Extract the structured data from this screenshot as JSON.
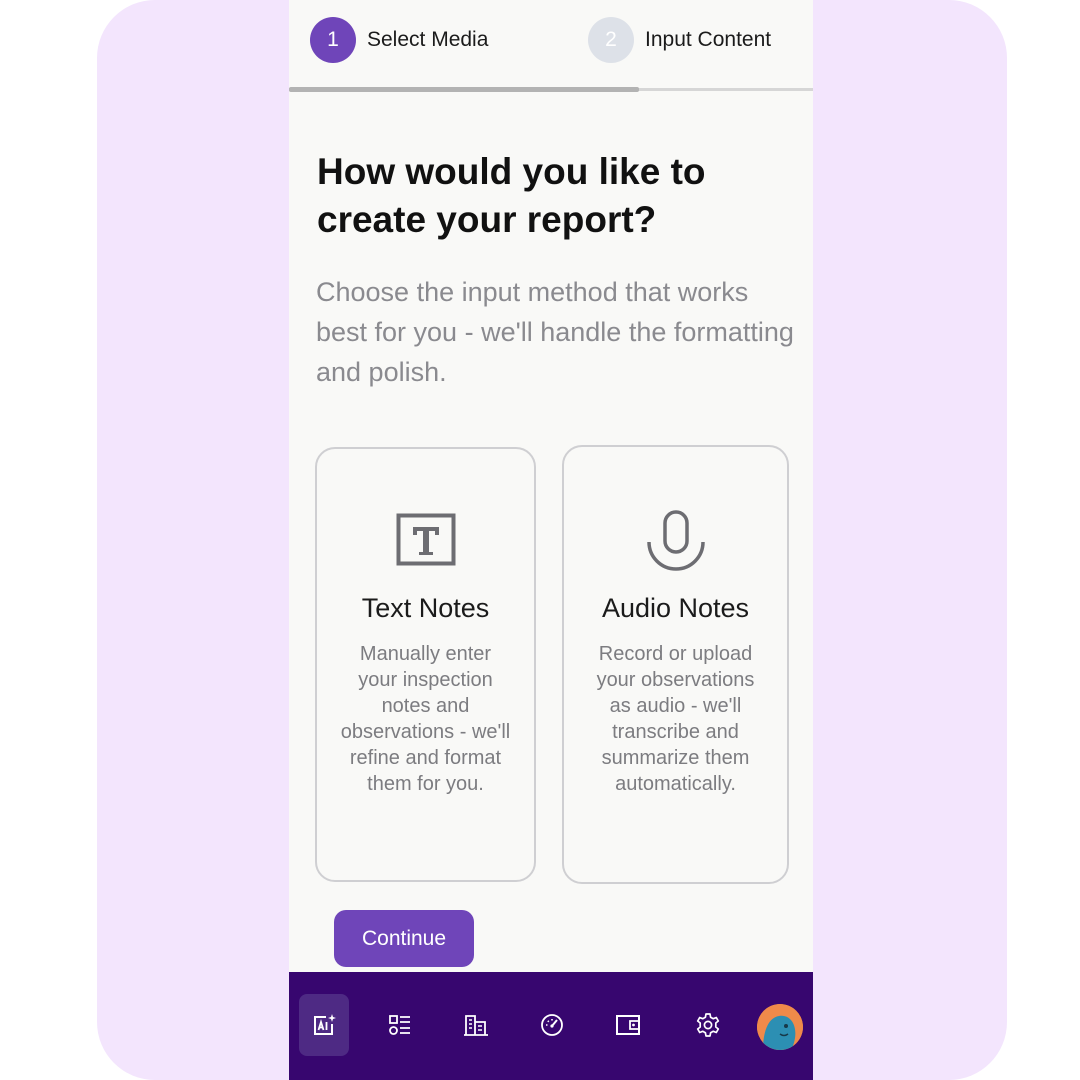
{
  "stepper": {
    "steps": [
      {
        "number": "1",
        "label": "Select Media",
        "state": "active"
      },
      {
        "number": "2",
        "label": "Input Content",
        "state": "inactive"
      }
    ],
    "progress": 0.667
  },
  "main": {
    "title": "How would you like to create your report?",
    "subtitle": "Choose the input method that works best for you - we'll handle the formatting and polish."
  },
  "options": [
    {
      "icon": "text-box-icon",
      "title": "Text Notes",
      "description": "Manually enter your inspection notes and observations - we'll refine and format them for you."
    },
    {
      "icon": "microphone-icon",
      "title": "Audio Notes",
      "description": "Record or upload your observations as audio - we'll transcribe and summarize them automatically."
    }
  ],
  "actions": {
    "continue_label": "Continue"
  },
  "bottom_nav": {
    "items": [
      {
        "icon": "ai-sparkle-icon",
        "active": true
      },
      {
        "icon": "checklist-icon",
        "active": false
      },
      {
        "icon": "building-icon",
        "active": false
      },
      {
        "icon": "dashboard-gauge-icon",
        "active": false
      },
      {
        "icon": "wallet-icon",
        "active": false
      },
      {
        "icon": "settings-gear-icon",
        "active": false
      },
      {
        "icon": "user-avatar",
        "active": false
      }
    ]
  },
  "colors": {
    "accent": "#6f45b9",
    "nav_background": "#37066f",
    "frame_background": "#f3e5fd"
  }
}
